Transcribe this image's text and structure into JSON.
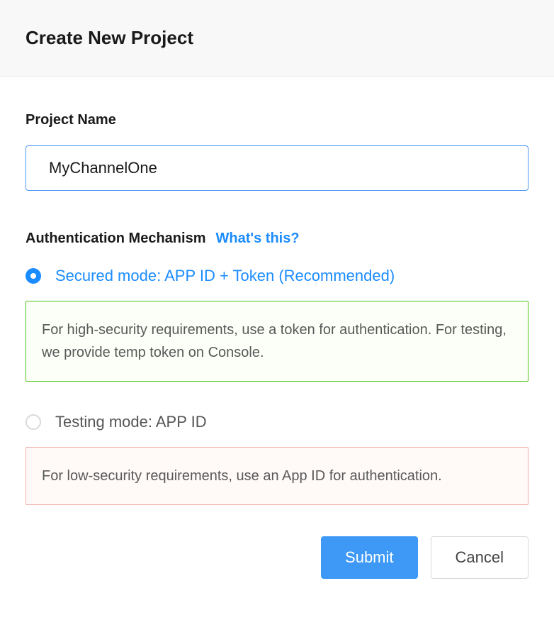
{
  "header": {
    "title": "Create New Project"
  },
  "form": {
    "project_name": {
      "label": "Project Name",
      "value": "MyChannelOne"
    },
    "auth": {
      "title": "Authentication Mechanism",
      "help_link": "What's this?",
      "options": {
        "secured": {
          "label": "Secured mode: APP ID + Token (Recommended)",
          "description": "For high-security requirements, use a token for authentication. For testing, we provide temp token on Console."
        },
        "testing": {
          "label": "Testing mode: APP ID",
          "description": "For low-security requirements, use an App ID for authentication."
        }
      }
    }
  },
  "actions": {
    "submit": "Submit",
    "cancel": "Cancel"
  }
}
